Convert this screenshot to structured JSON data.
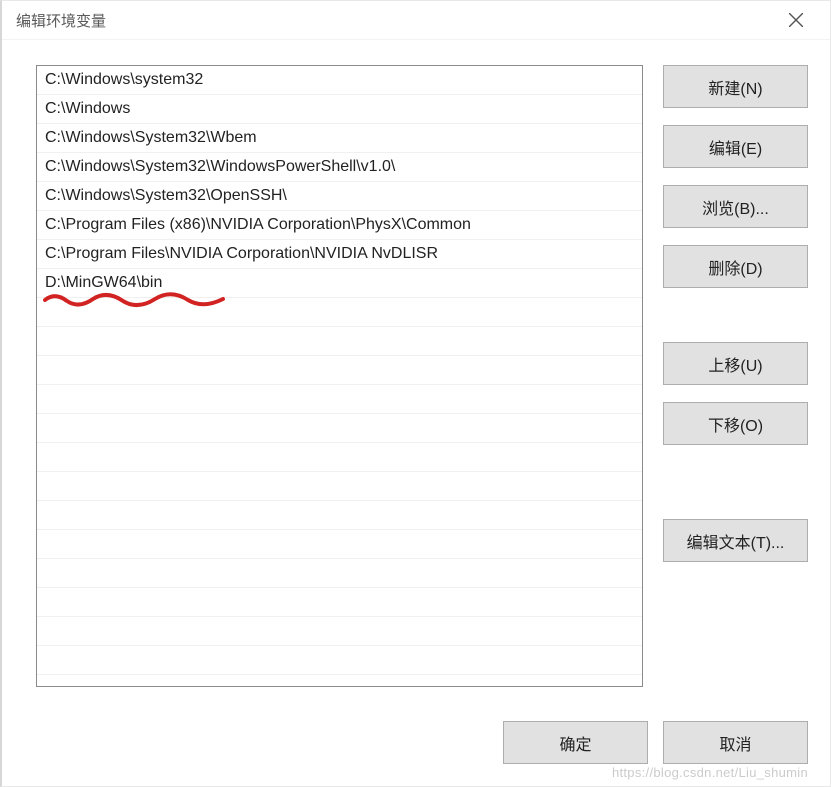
{
  "window": {
    "title": "编辑环境变量"
  },
  "paths": [
    "C:\\Windows\\system32",
    "C:\\Windows",
    "C:\\Windows\\System32\\Wbem",
    "C:\\Windows\\System32\\WindowsPowerShell\\v1.0\\",
    "C:\\Windows\\System32\\OpenSSH\\",
    "C:\\Program Files (x86)\\NVIDIA Corporation\\PhysX\\Common",
    "C:\\Program Files\\NVIDIA Corporation\\NVIDIA NvDLISR",
    "D:\\MinGW64\\bin"
  ],
  "buttons": {
    "new": "新建(N)",
    "edit": "编辑(E)",
    "browse": "浏览(B)...",
    "delete": "删除(D)",
    "moveUp": "上移(U)",
    "moveDown": "下移(O)",
    "editText": "编辑文本(T)...",
    "ok": "确定",
    "cancel": "取消"
  },
  "watermark": "https://blog.csdn.net/Liu_shumin"
}
